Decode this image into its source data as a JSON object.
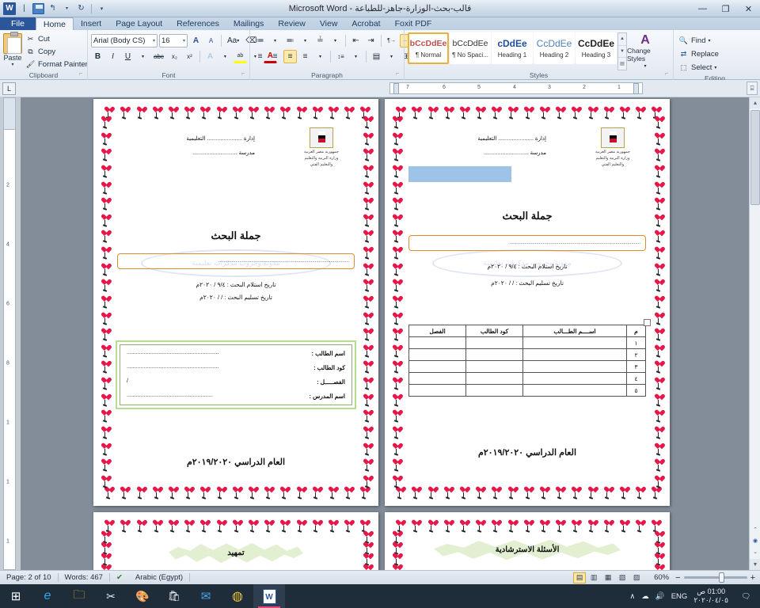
{
  "window": {
    "title": "قالب-بحث-الوزارة-جاهز-للطباعة  -  Microsoft Word",
    "app_badge": "W",
    "quick_access": {
      "save": "save-icon",
      "undo": "↰",
      "redo": "↻",
      "customize": "▾"
    },
    "controls": {
      "minimize": "—",
      "restore": "❐",
      "close": "✕"
    }
  },
  "tabs": [
    {
      "label": "File"
    },
    {
      "label": "Home"
    },
    {
      "label": "Insert"
    },
    {
      "label": "Page Layout"
    },
    {
      "label": "References"
    },
    {
      "label": "Mailings"
    },
    {
      "label": "Review"
    },
    {
      "label": "View"
    },
    {
      "label": "Acrobat"
    },
    {
      "label": "Foxit PDF"
    }
  ],
  "ribbon": {
    "clipboard": {
      "label": "Clipboard",
      "paste": "Paste",
      "cut": "Cut",
      "copy": "Copy",
      "format_painter": "Format Painter",
      "dialog": "⌐"
    },
    "font": {
      "label": "Font",
      "family": "Arial (Body CS)",
      "size": "16",
      "grow": "A",
      "shrink": "A",
      "change_case": "Aa",
      "clear_formatting": "⌫",
      "bold": "B",
      "italic": "I",
      "underline": "U",
      "strikethrough": "abc",
      "subscript": "x₂",
      "superscript": "x²",
      "text_effects": "A",
      "highlight": "ab",
      "font_color": "A",
      "dialog": "⌐"
    },
    "paragraph": {
      "label": "Paragraph",
      "bullets": "≔",
      "numbering": "≕",
      "multilevel": "≟",
      "decrease_indent": "⇤",
      "increase_indent": "⇥",
      "ltr": "¶→",
      "rtl": "←¶",
      "sort": "↓A",
      "show_marks": "¶",
      "align_left": "≡",
      "align_center": "≡",
      "align_right": "≡",
      "justify": "≡",
      "line_spacing": "↕≡",
      "shading": "▤",
      "borders": "⊞",
      "dialog": "⌐"
    },
    "styles": {
      "label": "Styles",
      "items": [
        {
          "preview": "bCcDdEe",
          "name": "¶ Normal",
          "selected": true
        },
        {
          "preview": "bCcDdEe",
          "name": "¶ No Spaci...",
          "selected": false
        },
        {
          "preview": "cDdEe",
          "name": "Heading 1",
          "selected": false
        },
        {
          "preview": "CcDdEe",
          "name": "Heading 2",
          "selected": false
        },
        {
          "preview": "CcDdEe",
          "name": "Heading 3",
          "selected": false
        }
      ],
      "change_styles": "Change Styles",
      "dialog": "⌐"
    },
    "editing": {
      "label": "Editing",
      "find": "Find",
      "replace": "Replace",
      "select": "Select"
    }
  },
  "ruler": {
    "tab_selector": "L",
    "marks": [
      "7",
      "6",
      "5",
      "4",
      "3",
      "2",
      "1"
    ]
  },
  "document": {
    "pages": [
      {
        "id": "page-1",
        "header": {
          "emblem_line1": "جمهورية مصر العربية",
          "emblem_line2": "وزارة التربية والتعليم",
          "emblem_line3": "والتعليم الفني",
          "field_administration": "إدارة ....................... التعليمية",
          "field_school": "مدرسة ............................."
        },
        "research_title_label": "جملة البحث",
        "research_title_value": "...................................................................................................",
        "date_received": "تاريخ استلام البحث :  ٩/٤ / ٢٠٢٠م",
        "date_submitted": "تاريخ تسليم البحث :    /    / ٢٠٢٠م",
        "student_box": [
          {
            "label": "اسم الطالب :",
            "value": "............................................................"
          },
          {
            "label": "كود الطالب :",
            "value": "............................................................"
          },
          {
            "label": "الفصـــــل  :",
            "value": "        /"
          },
          {
            "label": "اسم المدرس :",
            "value": "........................................................"
          }
        ],
        "academic_year": "العام الدراسي ٢٠١٩/٢٠٢٠م",
        "watermark": "مدونة وجروب مذكرات تعليمية"
      },
      {
        "id": "page-2",
        "header": {
          "emblem_line1": "جمهورية مصر العربية",
          "emblem_line2": "وزارة التربية والتعليم",
          "emblem_line3": "والتعليم الفني",
          "field_administration": "إدارة ....................... التعليمية",
          "field_school": "مدرسة ............................."
        },
        "selected_block": "",
        "research_title_label": "جملة البحث",
        "research_title_value": "...................................................................................................",
        "date_received": "تاريخ استلام البحث :  ٩/٤ / ٢٠٢٠م",
        "date_submitted": "تاريخ تسليم البحث :    /    / ٢٠٢٠م",
        "table": {
          "headers": [
            "م",
            "اســــم الطـــالب",
            "كود الطالب",
            "الفصل"
          ],
          "rows": [
            [
              "١",
              "",
              "",
              ""
            ],
            [
              "٢",
              "",
              "",
              ""
            ],
            [
              "٣",
              "",
              "",
              ""
            ],
            [
              "٤",
              "",
              "",
              ""
            ],
            [
              "٥",
              "",
              "",
              ""
            ]
          ]
        },
        "academic_year": "العام الدراسي ٢٠١٩/٢٠٢٠م",
        "watermark": "مدونة وجروب مذكرات تعليمية"
      },
      {
        "id": "page-3",
        "burst_title": "تمهيد"
      },
      {
        "id": "page-4",
        "burst_title": "الأسئلة الاسترشادية"
      }
    ]
  },
  "statusbar": {
    "page": "Page: 2 of 10",
    "words": "Words: 467",
    "proofing_icon": "spell-check-icon",
    "language": "Arabic (Egypt)",
    "views": [
      {
        "name": "print-layout",
        "glyph": "▤",
        "selected": true
      },
      {
        "name": "full-screen-reading",
        "glyph": "▥",
        "selected": false
      },
      {
        "name": "web-layout",
        "glyph": "▦",
        "selected": false
      },
      {
        "name": "outline",
        "glyph": "▧",
        "selected": false
      },
      {
        "name": "draft",
        "glyph": "▨",
        "selected": false
      }
    ],
    "zoom": "60%",
    "zoom_out": "−",
    "zoom_in": "+"
  },
  "taskbar": {
    "items": [
      {
        "name": "start-button",
        "glyph": "⊞"
      },
      {
        "name": "edge-icon",
        "glyph": "e"
      },
      {
        "name": "file-explorer-icon",
        "glyph": "🗀"
      },
      {
        "name": "snip-tool-icon",
        "glyph": "✂"
      },
      {
        "name": "paint-icon",
        "glyph": "🎨"
      },
      {
        "name": "store-icon",
        "glyph": "🛍"
      },
      {
        "name": "mail-icon",
        "glyph": "✉"
      },
      {
        "name": "chrome-icon",
        "glyph": "◍"
      },
      {
        "name": "word-icon",
        "glyph": "W"
      }
    ],
    "tray": {
      "chevron": "∧",
      "onedrive": "☁",
      "volume": "🔊",
      "language": "ENG",
      "time": "01:00 ص",
      "date": "٢٠٢٠/٠٤/٠٥",
      "action_center": "🗨"
    }
  },
  "colors": {
    "accent": "#2b579a",
    "orange_box": "#e08a2e",
    "green_box": "#b7dd93",
    "heart_red": "#e8174a",
    "selection_blue": "#9dc3e6",
    "burst_green": "#e2efd0"
  }
}
